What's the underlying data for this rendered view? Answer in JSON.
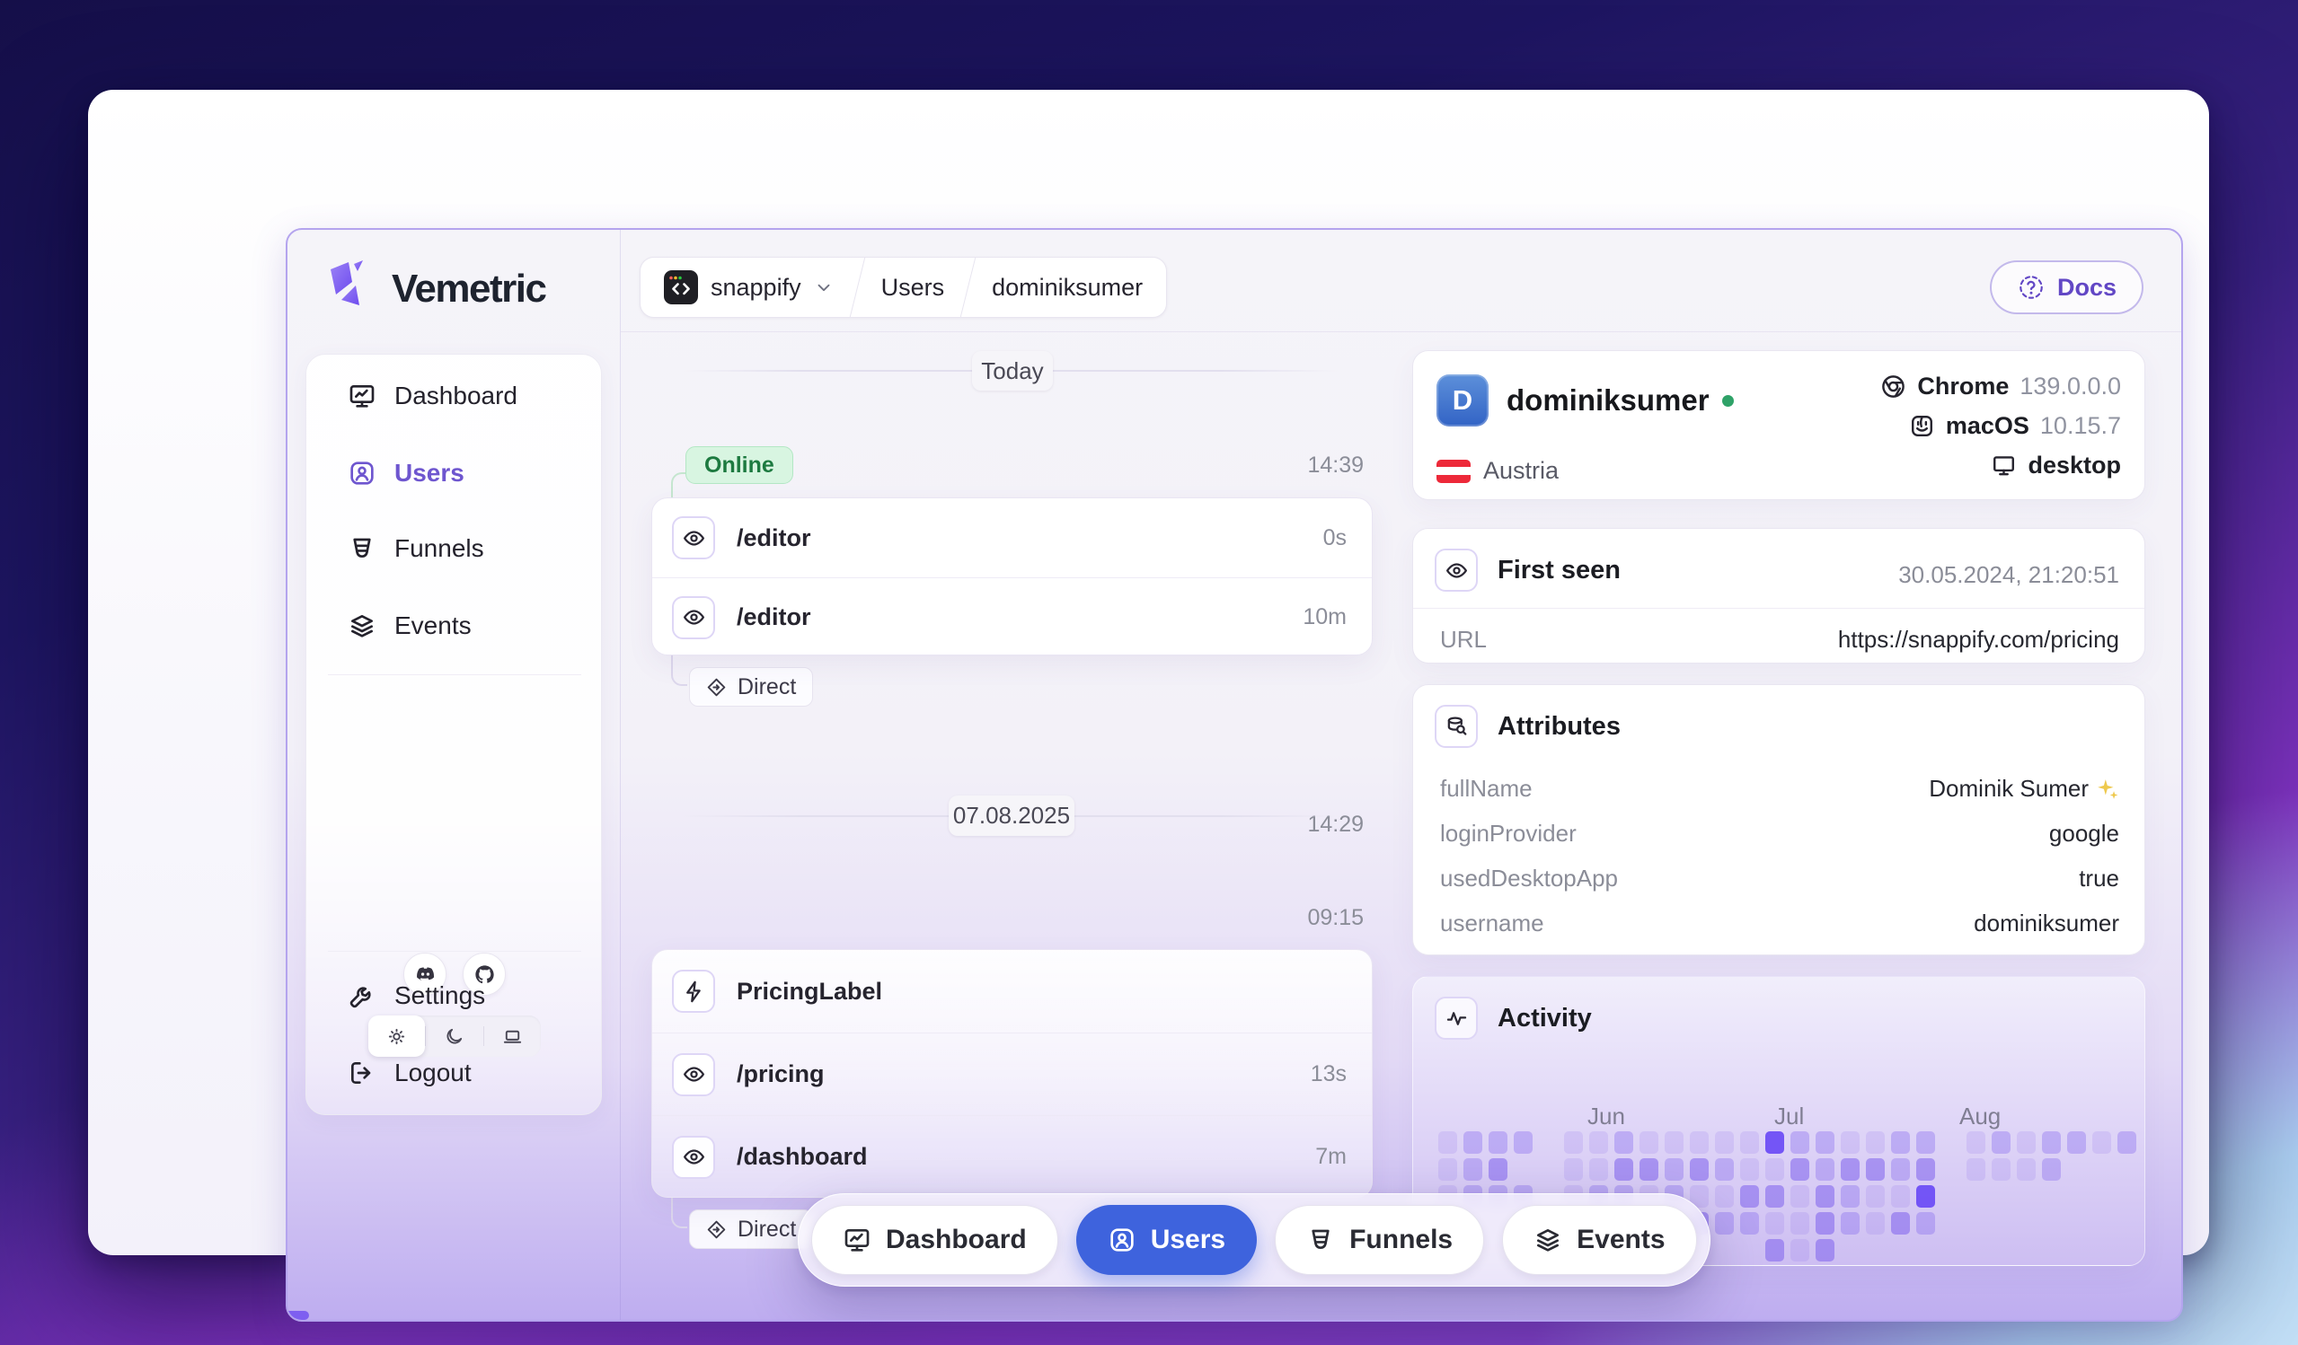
{
  "app": {
    "name": "Vemetric",
    "docs_label": "Docs"
  },
  "breadcrumb": {
    "project": "snappify",
    "section": "Users",
    "entity": "dominiksumer"
  },
  "sidebar": {
    "items": [
      {
        "label": "Dashboard",
        "active": false
      },
      {
        "label": "Users",
        "active": true
      },
      {
        "label": "Funnels",
        "active": false
      },
      {
        "label": "Events",
        "active": false
      }
    ],
    "settings_label": "Settings",
    "logout_label": "Logout",
    "theme_options": [
      "light",
      "dark",
      "system"
    ],
    "theme_active": "light"
  },
  "timeline": {
    "day_groups": [
      {
        "divider": "Today",
        "session": {
          "badge": "Online",
          "start_time": "14:39",
          "events": [
            {
              "label": "/editor",
              "duration": "0s"
            },
            {
              "label": "/editor",
              "duration": "10m"
            }
          ],
          "source_label": "Direct",
          "source_time": "14:29"
        }
      },
      {
        "divider": "07.08.2025",
        "session": {
          "start_time": "09:15",
          "events": [
            {
              "label": "PricingLabel",
              "duration": ""
            },
            {
              "label": "/pricing",
              "duration": "13s"
            },
            {
              "label": "/dashboard",
              "duration": "7m"
            }
          ],
          "source_label": "Direct"
        }
      }
    ]
  },
  "user": {
    "avatar_letter": "D",
    "name": "dominiksumer",
    "browser": "Chrome",
    "browser_version": "139.0.0.0",
    "os": "macOS",
    "os_version": "10.15.7",
    "device": "desktop",
    "country": "Austria"
  },
  "first_seen": {
    "title": "First seen",
    "timestamp": "30.05.2024, 21:20:51",
    "url_label": "URL",
    "url": "https://snappify.com/pricing"
  },
  "attributes": {
    "title": "Attributes",
    "rows": [
      {
        "key": "fullName",
        "value": "Dominik Sumer"
      },
      {
        "key": "loginProvider",
        "value": "google"
      },
      {
        "key": "usedDesktopApp",
        "value": "true"
      },
      {
        "key": "username",
        "value": "dominiksumer"
      }
    ]
  },
  "activity": {
    "title": "Activity",
    "months": [
      {
        "label": "Jun",
        "col": 5.3
      },
      {
        "label": "Jul",
        "col": 12.9
      },
      {
        "label": "Aug",
        "col": 20.4
      }
    ],
    "heatmap": [
      [
        1,
        2,
        2,
        2,
        0,
        1,
        1,
        2,
        1,
        1,
        1,
        1,
        1,
        4,
        2,
        2,
        1,
        1,
        2,
        2,
        0,
        1,
        2,
        1,
        2,
        2,
        1,
        2
      ],
      [
        1,
        2,
        3,
        0,
        0,
        1,
        1,
        3,
        3,
        2,
        3,
        2,
        1,
        1,
        3,
        2,
        3,
        3,
        2,
        3,
        0,
        1,
        1,
        1,
        2,
        0,
        0,
        0
      ],
      [
        1,
        2,
        2,
        2,
        0,
        1,
        2,
        2,
        1,
        2,
        1,
        1,
        3,
        3,
        1,
        3,
        2,
        1,
        1,
        4,
        0,
        0,
        0,
        0,
        0,
        0,
        0,
        0
      ],
      [
        0,
        0,
        0,
        0,
        0,
        0,
        0,
        0,
        0,
        1,
        3,
        2,
        2,
        1,
        1,
        3,
        2,
        1,
        3,
        2,
        0,
        0,
        0,
        0,
        0,
        0,
        0,
        0
      ],
      [
        0,
        0,
        0,
        0,
        0,
        0,
        0,
        0,
        0,
        0,
        0,
        0,
        0,
        3,
        1,
        3,
        0,
        0,
        0,
        0,
        0,
        0,
        0,
        0,
        0,
        0,
        0,
        0
      ]
    ]
  },
  "bottom_nav": {
    "items": [
      {
        "label": "Dashboard",
        "active": false
      },
      {
        "label": "Users",
        "active": true
      },
      {
        "label": "Funnels",
        "active": false
      },
      {
        "label": "Events",
        "active": false
      }
    ]
  },
  "colors": {
    "accent": "#6e56cf",
    "active_nav": "#3e63dd",
    "online": "#30a46c"
  }
}
